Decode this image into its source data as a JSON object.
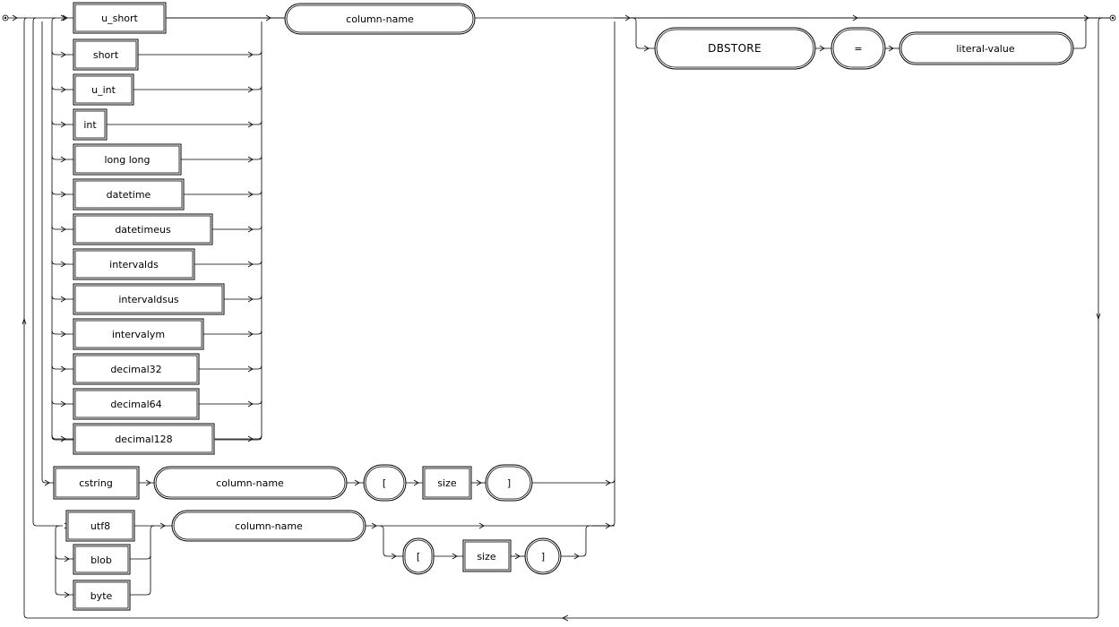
{
  "types": [
    {
      "label": "u_short",
      "kind": "keyword"
    },
    {
      "label": "short",
      "kind": "keyword"
    },
    {
      "label": "u_int",
      "kind": "keyword"
    },
    {
      "label": "int",
      "kind": "keyword"
    },
    {
      "label": "long long",
      "kind": "keyword"
    },
    {
      "label": "datetime",
      "kind": "keyword"
    },
    {
      "label": "datetimeus",
      "kind": "keyword"
    },
    {
      "label": "intervalds",
      "kind": "keyword"
    },
    {
      "label": "intervaldsus",
      "kind": "keyword"
    },
    {
      "label": "intervalym",
      "kind": "keyword"
    },
    {
      "label": "decimal32",
      "kind": "keyword"
    },
    {
      "label": "decimal64",
      "kind": "keyword"
    },
    {
      "label": "decimal128",
      "kind": "keyword"
    }
  ],
  "main_column_name": "column-name",
  "dbstore": {
    "keyword": "DBSTORE",
    "equals": "=",
    "value": "literal-value"
  },
  "cstring": {
    "keyword": "cstring",
    "column": "column-name",
    "open": "[",
    "size": "size",
    "close": "]"
  },
  "utf8_group": {
    "types": [
      "utf8",
      "blob",
      "byte"
    ],
    "column": "column-name",
    "open": "[",
    "size": "size",
    "close": "]"
  }
}
